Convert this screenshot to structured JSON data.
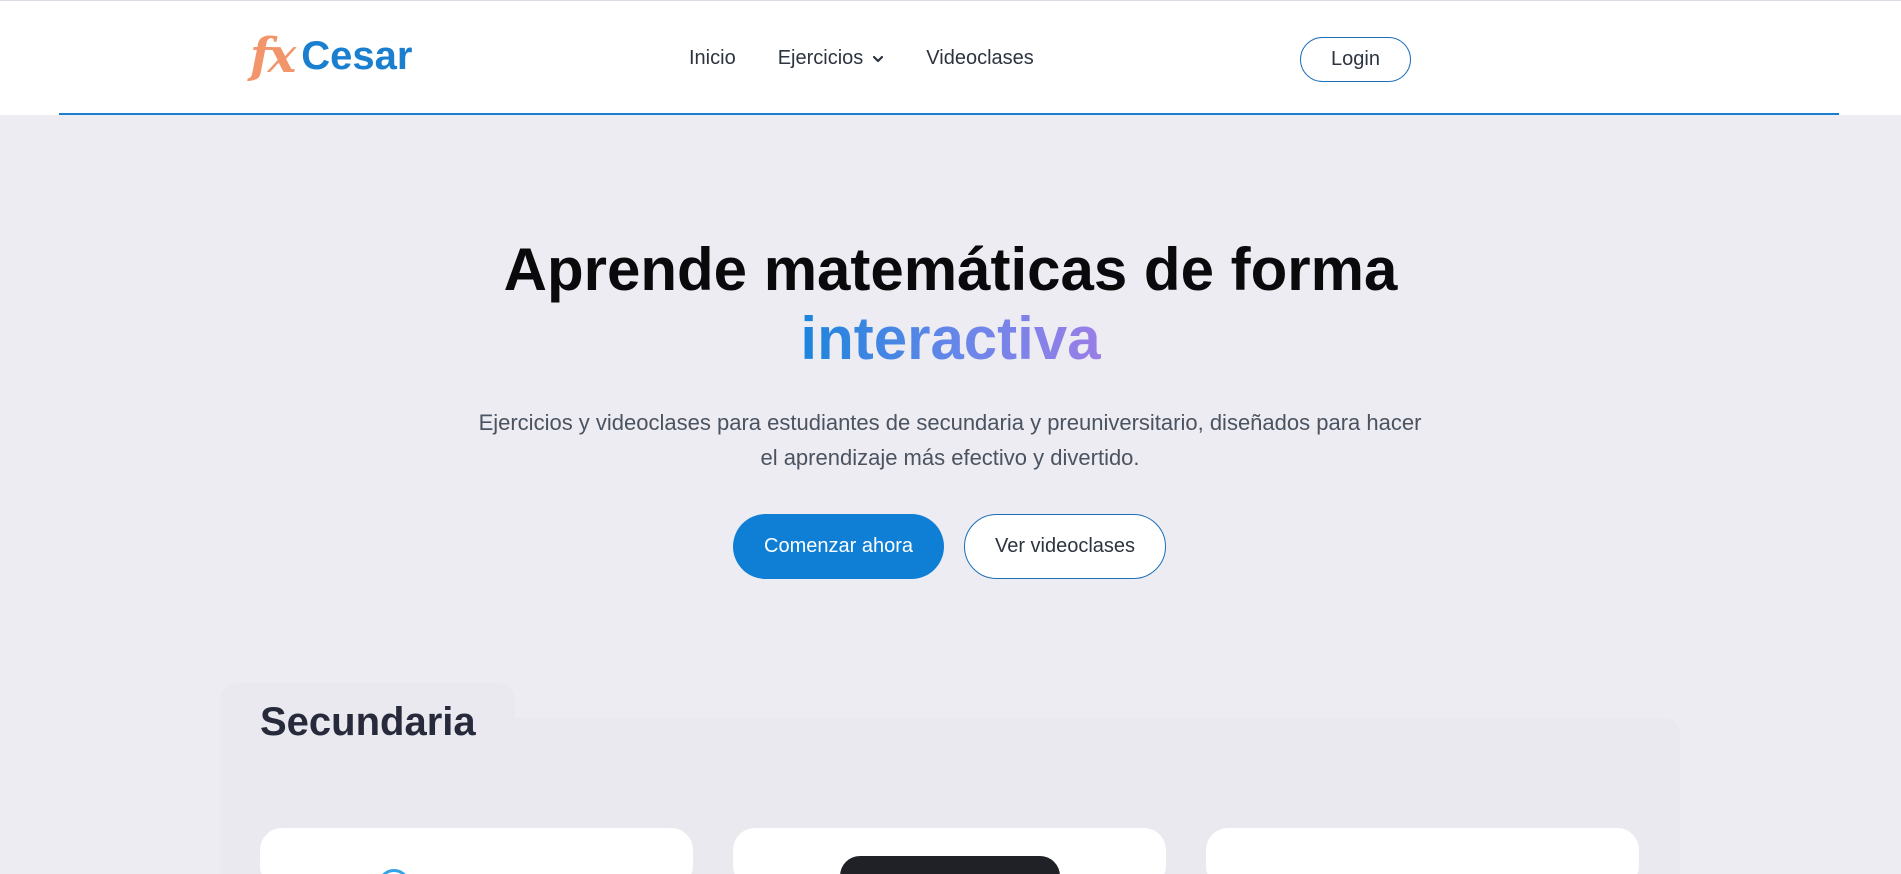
{
  "brand": {
    "logo_fx": "fx",
    "logo_name": "Cesar"
  },
  "nav": {
    "items": [
      {
        "label": "Inicio"
      },
      {
        "label": "Ejercicios"
      },
      {
        "label": "Videoclases"
      }
    ],
    "login_label": "Login"
  },
  "hero": {
    "title": "Aprende matemáticas de forma",
    "title_accent": "interactiva",
    "subtitle": "Ejercicios y videoclases para estudiantes de secundaria y preuniversitario, diseñados para hacer el aprendizaje más efectivo y divertido.",
    "primary_cta": "Comenzar ahora",
    "secondary_cta": "Ver videoclases"
  },
  "section": {
    "title": "Secundaria"
  },
  "colors": {
    "brand_blue": "#1b7fd0",
    "brand_orange": "#f2956b",
    "cta_blue": "#0f7fd6"
  }
}
